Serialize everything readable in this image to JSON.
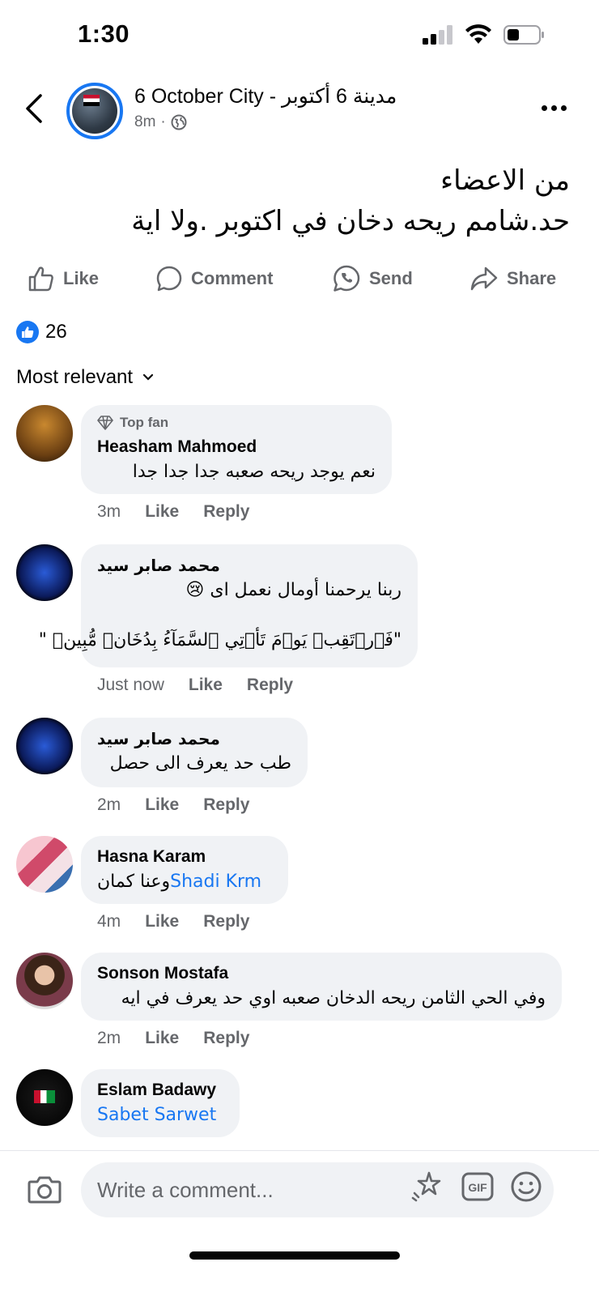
{
  "status_bar": {
    "time": "1:30"
  },
  "post": {
    "page_name": "6 October City - مدينة 6 أكتوبر",
    "age": "8m",
    "separator": "·",
    "text_line1": "من الاعضاء",
    "text_line2": "حد.شامم ريحه دخان في اكتوبر .ولا اية"
  },
  "actions": {
    "like": "Like",
    "comment": "Comment",
    "send": "Send",
    "share": "Share"
  },
  "reactions": {
    "count": "26"
  },
  "sort": {
    "label": "Most relevant"
  },
  "comments": [
    {
      "badge": "Top fan",
      "author": "Heasham Mahmoed",
      "text": "نعم يوجد ريحه صعبه جدا جدا جدا",
      "time": "3m",
      "like": "Like",
      "reply": "Reply"
    },
    {
      "author": "محمد صابر سيد",
      "text_line1": "ربنا يرحمنا أومال نعمل اى 😢",
      "text_line2": "\"فَٱرۡتَقِبۡ يَوۡمَ تَأۡتِي ٱلسَّمَآءُ بِدُخَانٖ مُّبِينٖ \"",
      "time": "Just now",
      "like": "Like",
      "reply": "Reply"
    },
    {
      "author": "محمد صابر سيد",
      "text": "طب حد يعرف الى حصل",
      "time": "2m",
      "like": "Like",
      "reply": "Reply"
    },
    {
      "author": "Hasna Karam",
      "mention": "Shadi Krm",
      "text": "وعنا كمان",
      "time": "4m",
      "like": "Like",
      "reply": "Reply"
    },
    {
      "author": "Sonson Mostafa",
      "text": "وفي الحي الثامن ريحه الدخان صعبه اوي حد يعرف في ايه",
      "time": "2m",
      "like": "Like",
      "reply": "Reply"
    },
    {
      "author": "Eslam Badawy",
      "mention": "Sabet Sarwet"
    }
  ],
  "composer": {
    "placeholder": "Write a comment..."
  },
  "colors": {
    "accent": "#1877f2",
    "bubble": "#f0f2f5",
    "muted": "#65676b"
  }
}
